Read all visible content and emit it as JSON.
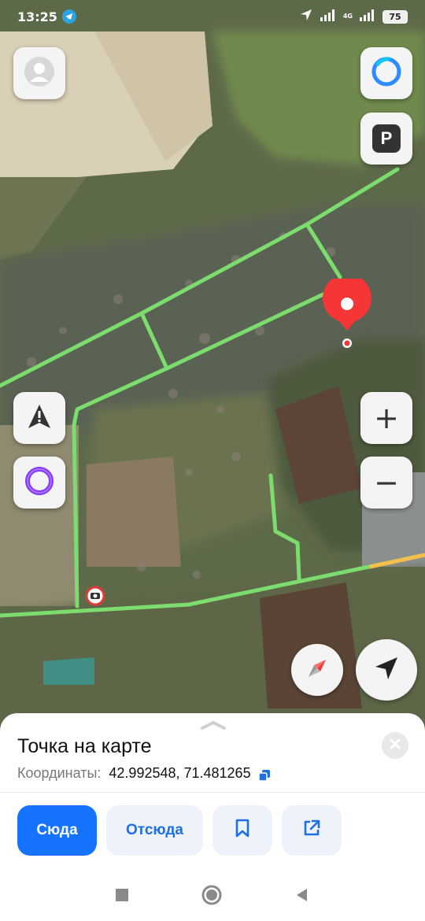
{
  "status_bar": {
    "time": "13:25",
    "network": "4G",
    "battery": "75"
  },
  "map": {
    "pin_color": "#f43636",
    "road_color": "#7cdc6e",
    "buttons": {
      "profile": "profile-icon",
      "alice_top": "alice-ring-icon",
      "parking": "P",
      "warning": "road-alert-icon",
      "alice": "alice-icon",
      "zoom_in": "+",
      "zoom_out": "−",
      "compass": "compass-icon",
      "locate": "my-location-icon"
    }
  },
  "sheet": {
    "title": "Точка на карте",
    "coords_label": "Координаты:",
    "coords_value": "42.992548, 71.481265",
    "actions": {
      "to_here": "Сюда",
      "from_here": "Отсюда",
      "bookmark": "bookmark-icon",
      "share": "share-icon"
    },
    "accent": "#1673ff"
  },
  "nav": {
    "recent": "square-icon",
    "home": "circle-icon",
    "back": "triangle-back-icon"
  }
}
